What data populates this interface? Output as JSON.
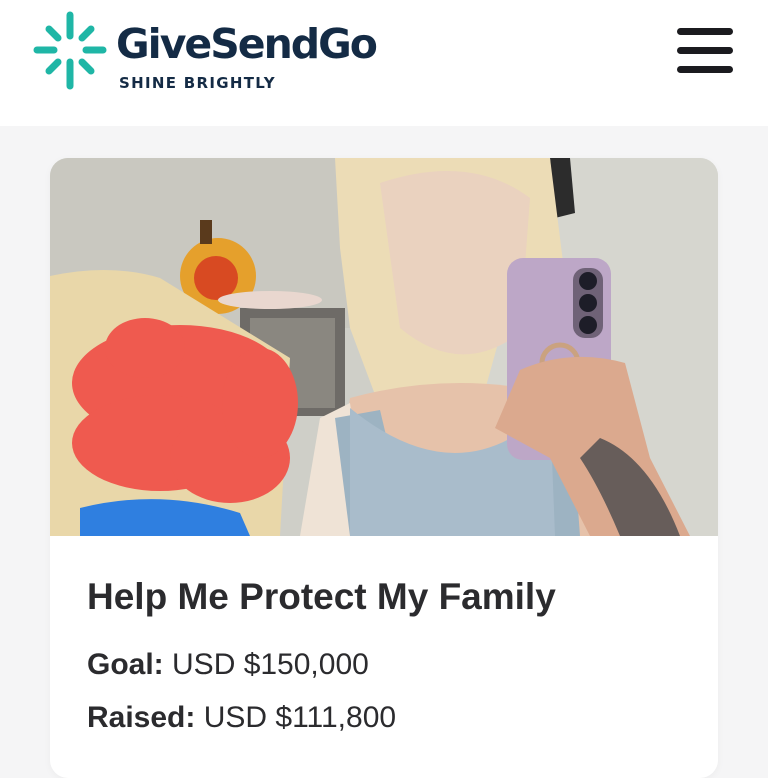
{
  "header": {
    "brand_name": "GiveSendGo",
    "tagline": "SHINE BRIGHTLY",
    "logo_icon": "burst-logo-icon",
    "menu_icon": "hamburger-menu-icon"
  },
  "campaign": {
    "image_alt": "Woman taking mirror selfie with a phone, child with face covered by red scribble",
    "title": "Help Me Protect My Family",
    "goal_label": "Goal:",
    "goal_value": "USD $150,000",
    "raised_label": "Raised:",
    "raised_value": "USD $111,800"
  },
  "colors": {
    "brand_teal": "#1fb6a6",
    "brand_navy": "#142b45",
    "text_dark": "#2b2b2e",
    "page_bg": "#f5f5f6"
  }
}
